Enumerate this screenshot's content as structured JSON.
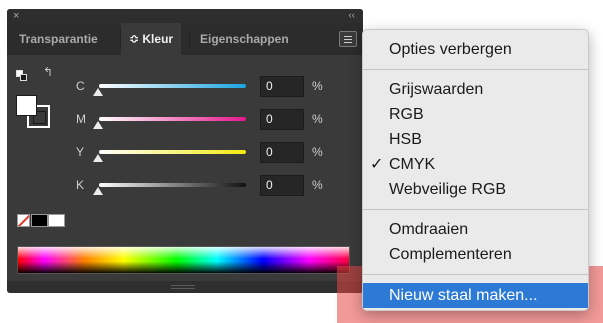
{
  "panel": {
    "close_glyph": "×",
    "collapse_glyph": "‹‹",
    "tabs": [
      {
        "label": "Transparantie"
      },
      {
        "label": "≎ Kleur"
      },
      {
        "label": "Eigenschappen"
      }
    ],
    "swap_glyph": "↰",
    "sliders": [
      {
        "label": "C",
        "value": "0",
        "unit": "%",
        "color": "#1aa3e0"
      },
      {
        "label": "M",
        "value": "0",
        "unit": "%",
        "color": "#e5178c"
      },
      {
        "label": "Y",
        "value": "0",
        "unit": "%",
        "color": "#f3ea0e"
      },
      {
        "label": "K",
        "value": "0",
        "unit": "%",
        "color": "#111111"
      }
    ]
  },
  "menu": {
    "items": [
      {
        "label": "Opties verbergen"
      },
      {
        "label": "Grijswaarden"
      },
      {
        "label": "RGB"
      },
      {
        "label": "HSB"
      },
      {
        "label": "CMYK",
        "checked": true,
        "check_glyph": "✓"
      },
      {
        "label": "Webveilige RGB"
      },
      {
        "label": "Omdraaien"
      },
      {
        "label": "Complementeren"
      },
      {
        "label": "Nieuw staal maken...",
        "selected": true
      }
    ]
  },
  "colors": {
    "panel_bg": "#3a3a3a",
    "menu_bg": "#eaeaea",
    "selection": "#2c7ad6",
    "highlight": "#e84646"
  }
}
